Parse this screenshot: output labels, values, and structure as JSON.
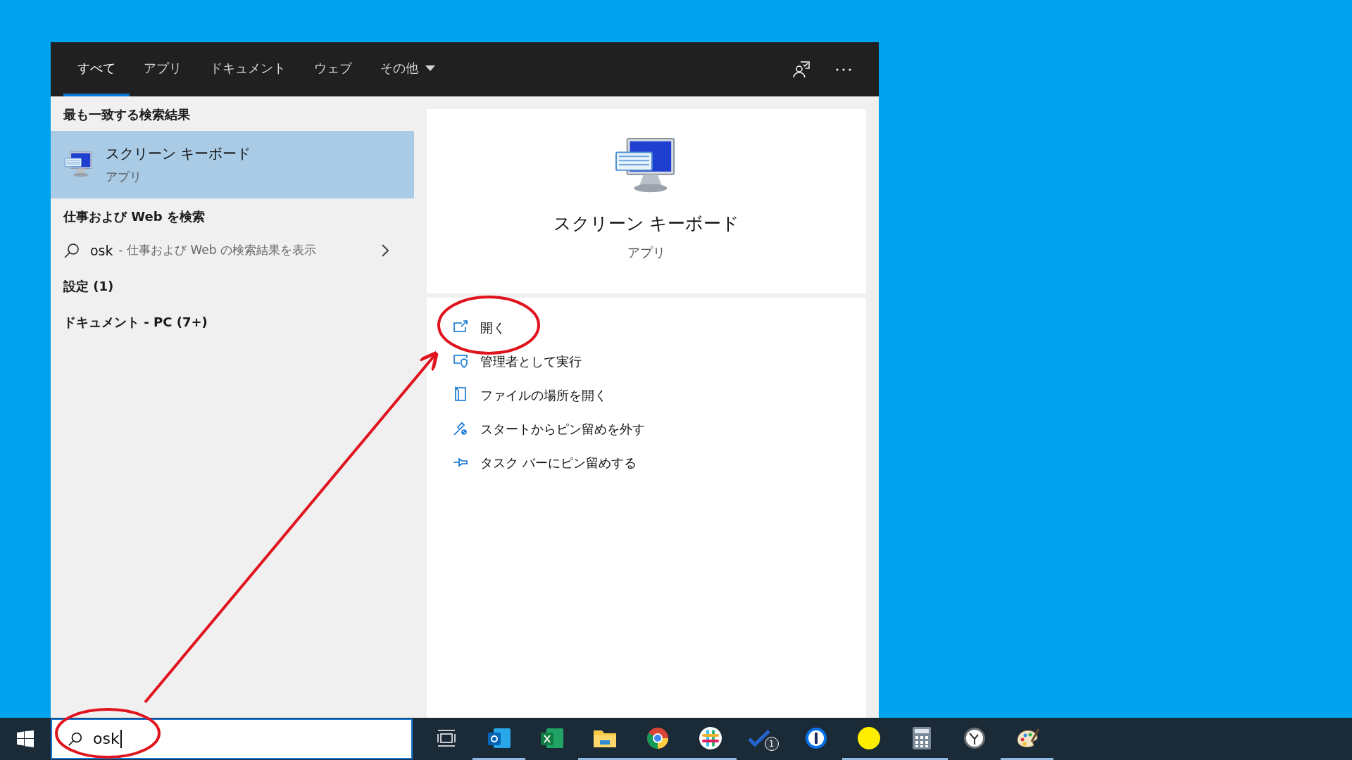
{
  "tabs": [
    {
      "label": "すべて",
      "selected": true,
      "kind": "plain"
    },
    {
      "label": "アプリ",
      "selected": false,
      "kind": "plain"
    },
    {
      "label": "ドキュメント",
      "selected": false,
      "kind": "plain"
    },
    {
      "label": "ウェブ",
      "selected": false,
      "kind": "plain"
    },
    {
      "label": "その他",
      "selected": false,
      "kind": "dropdown"
    }
  ],
  "results": {
    "best_match_heading": "最も一致する検索結果",
    "best_match": {
      "title": "スクリーン キーボード",
      "subtitle": "アプリ",
      "selected": true
    },
    "web_heading": "仕事および Web を検索",
    "web_suggestion": {
      "query": "osk",
      "hint": "- 仕事および Web の検索結果を表示"
    },
    "groups": [
      "設定 (1)",
      "ドキュメント - PC (7+)"
    ]
  },
  "preview": {
    "title": "スクリーン キーボード",
    "subtitle": "アプリ",
    "actions": [
      {
        "label": "開く",
        "kind": "open"
      },
      {
        "label": "管理者として実行",
        "kind": "admin"
      },
      {
        "label": "ファイルの場所を開く",
        "kind": "folder"
      },
      {
        "label": "スタートからピン留めを外す",
        "kind": "unpin"
      },
      {
        "label": "タスク バーにピン留めする",
        "kind": "pin"
      }
    ]
  },
  "search_box": {
    "value": "osk"
  },
  "taskbar": [
    {
      "kind": "taskview",
      "running": false
    },
    {
      "kind": "outlook",
      "running": true
    },
    {
      "kind": "excel",
      "running": false
    },
    {
      "kind": "explorer",
      "running": true
    },
    {
      "kind": "chrome",
      "running": true
    },
    {
      "kind": "slack",
      "running": true
    },
    {
      "kind": "todo",
      "running": false,
      "badge": "1"
    },
    {
      "kind": "password",
      "running": false
    },
    {
      "kind": "dot",
      "running": true
    },
    {
      "kind": "calculator",
      "running": true
    },
    {
      "kind": "clock",
      "running": false
    },
    {
      "kind": "paint",
      "running": true
    }
  ]
}
